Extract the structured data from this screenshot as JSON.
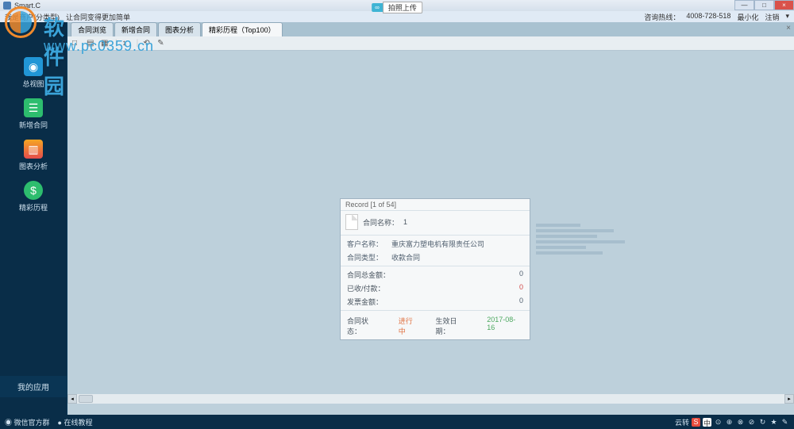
{
  "app": {
    "title": "Smart.C"
  },
  "upload": {
    "icon_label": "∞",
    "text": "拍照上传"
  },
  "window_controls": {
    "minimize": "—",
    "maximize": "□",
    "close": "×"
  },
  "menubar": {
    "left": [
      "我是商户(分类型)",
      "让合同变得更加简单"
    ],
    "right": {
      "hotline_label": "咨询热线：",
      "hotline_number": "4008-728-518",
      "minimize": "最小化",
      "logout": "注销",
      "dropdown": "▾"
    }
  },
  "watermark": {
    "line1": "软件园",
    "line2": "www.pc0359.cn"
  },
  "sidebar": {
    "items": [
      {
        "label": "总视图",
        "icon": "eye"
      },
      {
        "label": "新增合同",
        "icon": "checklist"
      },
      {
        "label": "图表分析",
        "icon": "chart"
      },
      {
        "label": "精彩历程",
        "icon": "dollar"
      }
    ],
    "bottom": "我的应用"
  },
  "tabs": [
    {
      "label": "合同浏览",
      "active": false
    },
    {
      "label": "新增合同",
      "active": false
    },
    {
      "label": "图表分析",
      "active": false
    },
    {
      "label": "精彩历程（Top100）",
      "active": true
    }
  ],
  "tab_close_all": "×",
  "toolbar": {
    "icons": [
      "□",
      "▤",
      "▦",
      "↕",
      "⟲",
      "✎"
    ]
  },
  "record": {
    "header": "Record [1 of 54]",
    "title_label": "合同名称：",
    "title_value": "1",
    "customer_label": "客户名称：",
    "customer_value": "重庆富力塑电机有限责任公司",
    "type_label": "合同类型：",
    "type_value": "收款合同",
    "amount_total_label": "合同总金额：",
    "amount_total": "0",
    "amount_paid_label": "已收/付款：",
    "amount_paid": "0",
    "amount_invoice_label": "发票金额：",
    "amount_invoice": "0",
    "status_label": "合同状态：",
    "status_value": "进行中",
    "effective_label": "生效日期：",
    "effective_value": "2017-08-16"
  },
  "taskbar": {
    "left": [
      "微信官方群",
      "在线教程"
    ],
    "right_prefix": "云转",
    "tray": [
      "S",
      "中",
      "⊙",
      "⊕",
      "⊗",
      "⊘",
      "↻",
      "★",
      "✎"
    ]
  }
}
